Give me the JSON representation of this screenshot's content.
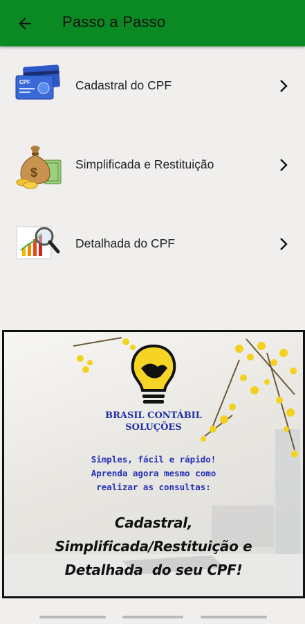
{
  "app_bar": {
    "title": "Passo a Passo",
    "back_icon": "arrow-left-icon",
    "color": "#0b8a23"
  },
  "menu": {
    "items": [
      {
        "label": "Cadastral do CPF",
        "icon": "cpf-card-icon"
      },
      {
        "label": "Simplificada e Restituição",
        "icon": "money-bag-icon"
      },
      {
        "label": "Detalhada do CPF",
        "icon": "chart-magnifier-icon"
      }
    ],
    "chevron_icon": "chevron-right-icon"
  },
  "banner": {
    "brand_line1": "BRASIL CONTÁBIL",
    "brand_line2": "SOLUÇÕES",
    "tagline_line1": "Simples, fácil e rápido!",
    "tagline_line2": "Aprenda agora mesmo como",
    "tagline_line3": "realizar as consultas:",
    "headline_line1": "Cadastral,",
    "headline_line2": "Simplificada/Restituição e",
    "headline_line3": "Detalhada  do seu CPF!",
    "logo_icon": "lightbulb-handshake-icon"
  }
}
